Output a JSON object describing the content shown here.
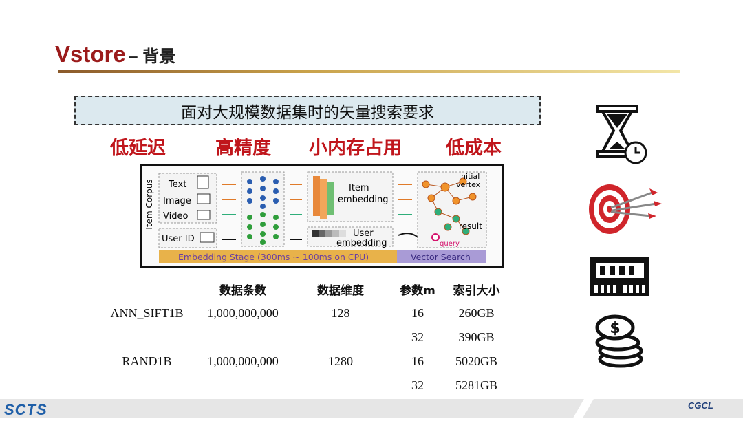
{
  "slide": {
    "title": "Vstore",
    "title_suffix": "– 背景",
    "banner": "面对大规模数据集时的矢量搜索要求",
    "requirements": [
      "低延迟",
      "高精度",
      "小内存占用",
      "低成本"
    ]
  },
  "diagram": {
    "corpus_label": "Item Corpus",
    "inputs": [
      "Text",
      "Image",
      "Video"
    ],
    "user_id": "User ID",
    "item_embedding": [
      "Item",
      "embedding"
    ],
    "user_embedding": [
      "User",
      "embedding"
    ],
    "initial_vertex": [
      "initial",
      "vertex"
    ],
    "result": "result",
    "query": "query",
    "stage_embedding": "Embedding Stage (300ms ~ 100ms on CPU)",
    "stage_search": "Vector  Search"
  },
  "table": {
    "headers": [
      "",
      "数据条数",
      "数据维度",
      "参数m",
      "索引大小"
    ],
    "rows": [
      [
        "ANN_SIFT1B",
        "1,000,000,000",
        "128",
        "16",
        "260GB"
      ],
      [
        "",
        "",
        "",
        "32",
        "390GB"
      ],
      [
        "RAND1B",
        "1,000,000,000",
        "1280",
        "16",
        "5020GB"
      ],
      [
        "",
        "",
        "",
        "32",
        "5281GB"
      ]
    ]
  },
  "footer": {
    "logo_left": "SCTS",
    "logo_right": "CGCL"
  },
  "icons": [
    "hourglass-clock-icon",
    "target-arrows-icon",
    "memory-chip-icon",
    "coin-stack-icon"
  ],
  "colors": {
    "title": "#9b1b1b",
    "requirements": "#c0161c",
    "banner_bg": "#dce9ef"
  }
}
